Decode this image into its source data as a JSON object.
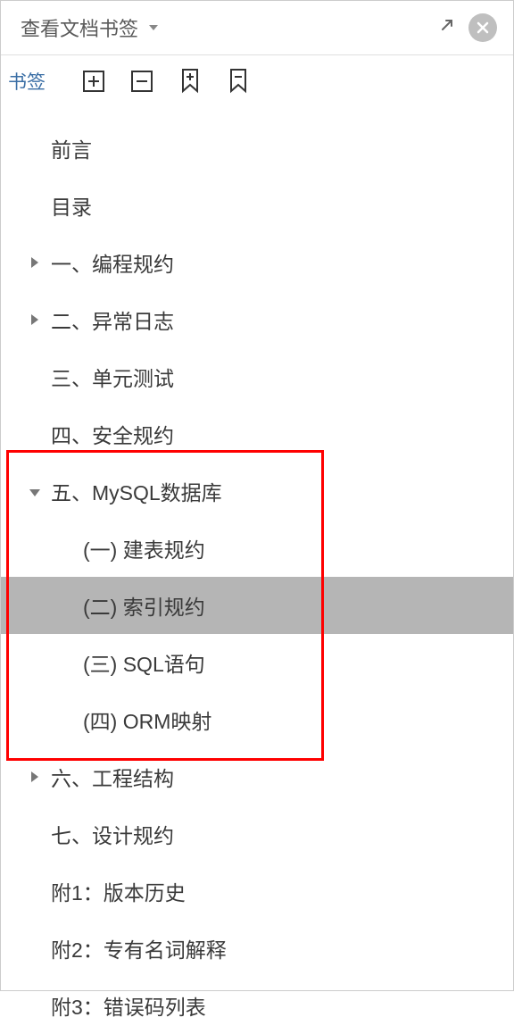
{
  "header": {
    "title": "查看文档书签"
  },
  "toolbar": {
    "label": "书签"
  },
  "tree": {
    "items": [
      {
        "label": "前言",
        "level": 0,
        "expandable": false
      },
      {
        "label": "目录",
        "level": 0,
        "expandable": false
      },
      {
        "label": "一、编程规约",
        "level": 0,
        "expandable": true,
        "expanded": false
      },
      {
        "label": "二、异常日志",
        "level": 0,
        "expandable": true,
        "expanded": false
      },
      {
        "label": "三、单元测试",
        "level": 0,
        "expandable": false
      },
      {
        "label": "四、安全规约",
        "level": 0,
        "expandable": false
      },
      {
        "label": "五、MySQL数据库",
        "level": 0,
        "expandable": true,
        "expanded": true
      },
      {
        "label": "(一) 建表规约",
        "level": 1,
        "expandable": false
      },
      {
        "label": "(二) 索引规约",
        "level": 1,
        "expandable": false,
        "selected": true
      },
      {
        "label": "(三) SQL语句",
        "level": 1,
        "expandable": false
      },
      {
        "label": "(四) ORM映射",
        "level": 1,
        "expandable": false
      },
      {
        "label": "六、工程结构",
        "level": 0,
        "expandable": true,
        "expanded": false
      },
      {
        "label": "七、设计规约",
        "level": 0,
        "expandable": false
      },
      {
        "label": "附1：版本历史",
        "level": 0,
        "expandable": false
      },
      {
        "label": "附2：专有名词解释",
        "level": 0,
        "expandable": false
      },
      {
        "label": "附3：错误码列表",
        "level": 0,
        "expandable": false
      }
    ],
    "highlight": {
      "startIndex": 6,
      "endIndex": 10
    }
  }
}
